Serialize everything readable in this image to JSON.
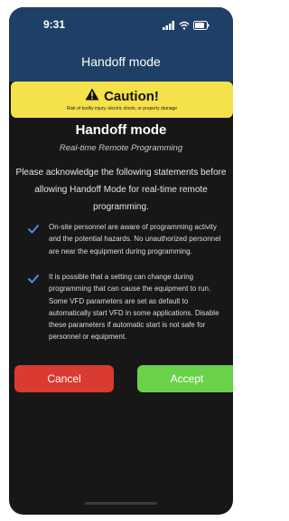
{
  "status_bar": {
    "time": "9:31",
    "icons": [
      "signal-icon",
      "wifi-icon",
      "battery-icon"
    ]
  },
  "header": {
    "title": "Handoff mode"
  },
  "caution": {
    "title": "Caution!",
    "subtitle": "Risk of bodily injury, electric shock, or property damage",
    "icon": "warning-icon",
    "color": "#f5e14a"
  },
  "dialog": {
    "title": "Handoff mode",
    "subtitle": "Real-time Remote Programming",
    "intro": "Please acknowledge the following statements before allowing Handoff Mode for real-time remote programming.",
    "acknowledgements": [
      {
        "checked": true,
        "text": "On-site personnel are aware of programming activity and the potential hazards. No unauthorized personnel are near the equipment during programming."
      },
      {
        "checked": true,
        "text": "It is possible that a setting can change during programming that can cause the equipment to run. Some VFD parameters are set as default to automatically start VFD in some applications. Disable these parameters if automatic start is not safe for personnel or equipment."
      }
    ]
  },
  "buttons": {
    "cancel_label": "Cancel",
    "accept_label": "Accept"
  },
  "colors": {
    "header_bg": "#1e4066",
    "background": "#171717",
    "cancel": "#d93a31",
    "accept": "#6ad14a",
    "checkmark": "#4a90e2"
  }
}
